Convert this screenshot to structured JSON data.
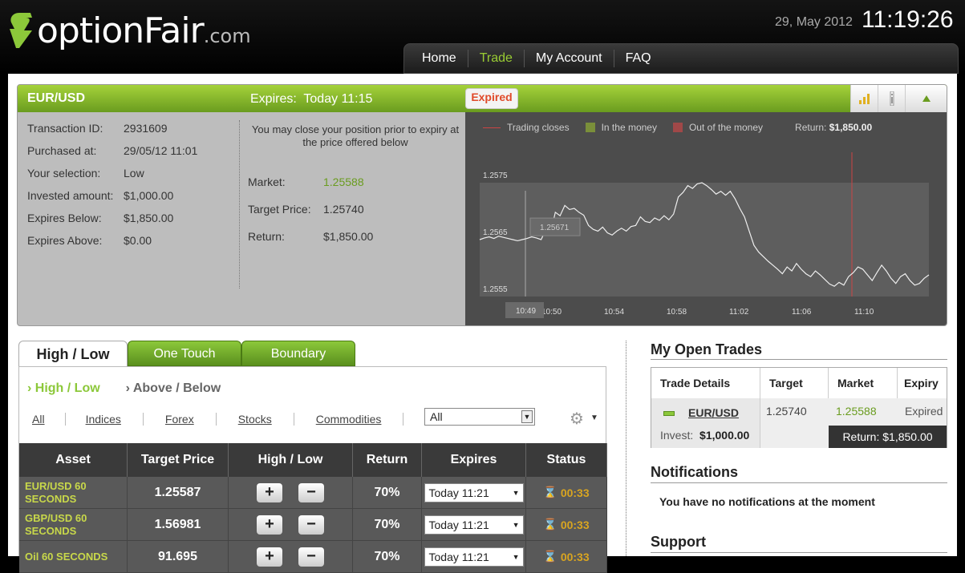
{
  "header": {
    "logo_main": "optionFair",
    "logo_suffix": ".com",
    "date": "29, May 2012",
    "time": "11:19:26"
  },
  "nav": {
    "items": [
      {
        "label": "Home"
      },
      {
        "label": "Trade",
        "active": true
      },
      {
        "label": "My Account"
      },
      {
        "label": "FAQ"
      }
    ]
  },
  "trade": {
    "pair": "EUR/USD",
    "expires_label": "Expires:",
    "expires_value": "Today 11:15",
    "status_badge": "Expired",
    "details": [
      {
        "label": "Transaction ID:",
        "value": "2931609"
      },
      {
        "label": "Purchased at:",
        "value": "29/05/12 11:01"
      },
      {
        "label": "Your selection:",
        "value": "Low"
      },
      {
        "label": "Invested amount:",
        "value": "$1,000.00"
      },
      {
        "label": "Expires Below:",
        "value": "$1,850.00"
      },
      {
        "label": "Expires Above:",
        "value": "$0.00"
      }
    ],
    "close_note": "You may close your position prior to expiry at the price offered below",
    "market_label": "Market:",
    "market_value": "1.25588",
    "target_label": "Target Price:",
    "target_value": "1.25740",
    "return_label": "Return:",
    "return_value": "$1,850.00"
  },
  "chart_data": {
    "type": "line",
    "legend": [
      {
        "label": "Trading closes",
        "color": "#c44"
      },
      {
        "label": "In the money",
        "color": "#7a8f3a"
      },
      {
        "label": "Out of the money",
        "color": "#a04848"
      }
    ],
    "return_label": "Return:",
    "return_value": "$1,850.00",
    "y_ticks": [
      "1.2575",
      "1.2565",
      "1.2555"
    ],
    "x_ticks": [
      "10:50",
      "10:54",
      "10:58",
      "11:02",
      "11:06",
      "11:10"
    ],
    "ylim": [
      1.2555,
      1.2575
    ],
    "purchase_time_label": "10:49",
    "purchase_price_label": "1.25671",
    "target_price": 1.25671,
    "series": [
      {
        "values": [
          1.2565,
          1.25653,
          1.25655,
          1.25652,
          1.25656,
          1.25654,
          1.25652,
          1.2565,
          1.25648,
          1.2565,
          1.25652,
          1.25655,
          1.25653,
          1.2565,
          1.25668,
          1.25662,
          1.25698,
          1.25692,
          1.2571,
          1.25703,
          1.25705,
          1.25698,
          1.25693,
          1.25675,
          1.25668,
          1.25665,
          1.25672,
          1.25662,
          1.25658,
          1.25665,
          1.2567,
          1.25665,
          1.25673,
          1.25675,
          1.2569,
          1.25682,
          1.2568,
          1.25688,
          1.25684,
          1.25692,
          1.25685,
          1.25695,
          1.25725,
          1.25733,
          1.25745,
          1.2574,
          1.25748,
          1.2575,
          1.25745,
          1.25738,
          1.2573,
          1.25735,
          1.25728,
          1.25735,
          1.25722,
          1.25705,
          1.2569,
          1.25665,
          1.2564,
          1.25628,
          1.2562,
          1.25612,
          1.25605,
          1.25598,
          1.2559,
          1.25602,
          1.25595,
          1.25608,
          1.25598,
          1.2559,
          1.25585,
          1.25595,
          1.25588,
          1.2558,
          1.25572,
          1.25568,
          1.25575,
          1.2557,
          1.25585,
          1.25592,
          1.25602,
          1.25598,
          1.25588,
          1.25578,
          1.25592,
          1.25605,
          1.25595,
          1.25582,
          1.25573,
          1.25585,
          1.2559,
          1.25578,
          1.2557,
          1.25573,
          1.25582,
          1.25588
        ]
      }
    ]
  },
  "tabs": [
    {
      "label": "High / Low",
      "active": true
    },
    {
      "label": "One Touch"
    },
    {
      "label": "Boundary"
    }
  ],
  "subtabs": [
    {
      "label": "High / Low",
      "active": true
    },
    {
      "label": "Above / Below"
    }
  ],
  "filters": [
    "All",
    "Indices",
    "Forex",
    "Stocks",
    "Commodities"
  ],
  "filter_select": "All",
  "assets_table": {
    "headers": [
      "Asset",
      "Target Price",
      "High / Low",
      "Return",
      "Expires",
      "Status"
    ],
    "rows": [
      {
        "asset": "EUR/USD 60 SECONDS",
        "target": "1.25587",
        "return": "70%",
        "expires": "Today 11:21",
        "status": "00:33"
      },
      {
        "asset": "GBP/USD 60 SECONDS",
        "target": "1.56981",
        "return": "70%",
        "expires": "Today 11:21",
        "status": "00:33"
      },
      {
        "asset": "Oil 60 SECONDS",
        "target": "91.695",
        "return": "70%",
        "expires": "Today 11:21",
        "status": "00:33"
      }
    ]
  },
  "open_trades": {
    "title": "My Open Trades",
    "headers": [
      "Trade Details",
      "Target",
      "Market",
      "Expiry"
    ],
    "row": {
      "pair": "EUR/USD",
      "target": "1.25740",
      "market": "1.25588",
      "expiry": "Expired",
      "invest_label": "Invest:",
      "invest_value": "$1,000.00",
      "return_label": "Return:",
      "return_value": "$1,850.00"
    }
  },
  "notifications": {
    "title": "Notifications",
    "message": "You have no notifications at the moment"
  },
  "support": {
    "title": "Support"
  },
  "colors": {
    "brand_green": "#8cc83a",
    "accent_red": "#e04a2a",
    "status_gold": "#d9a520"
  }
}
